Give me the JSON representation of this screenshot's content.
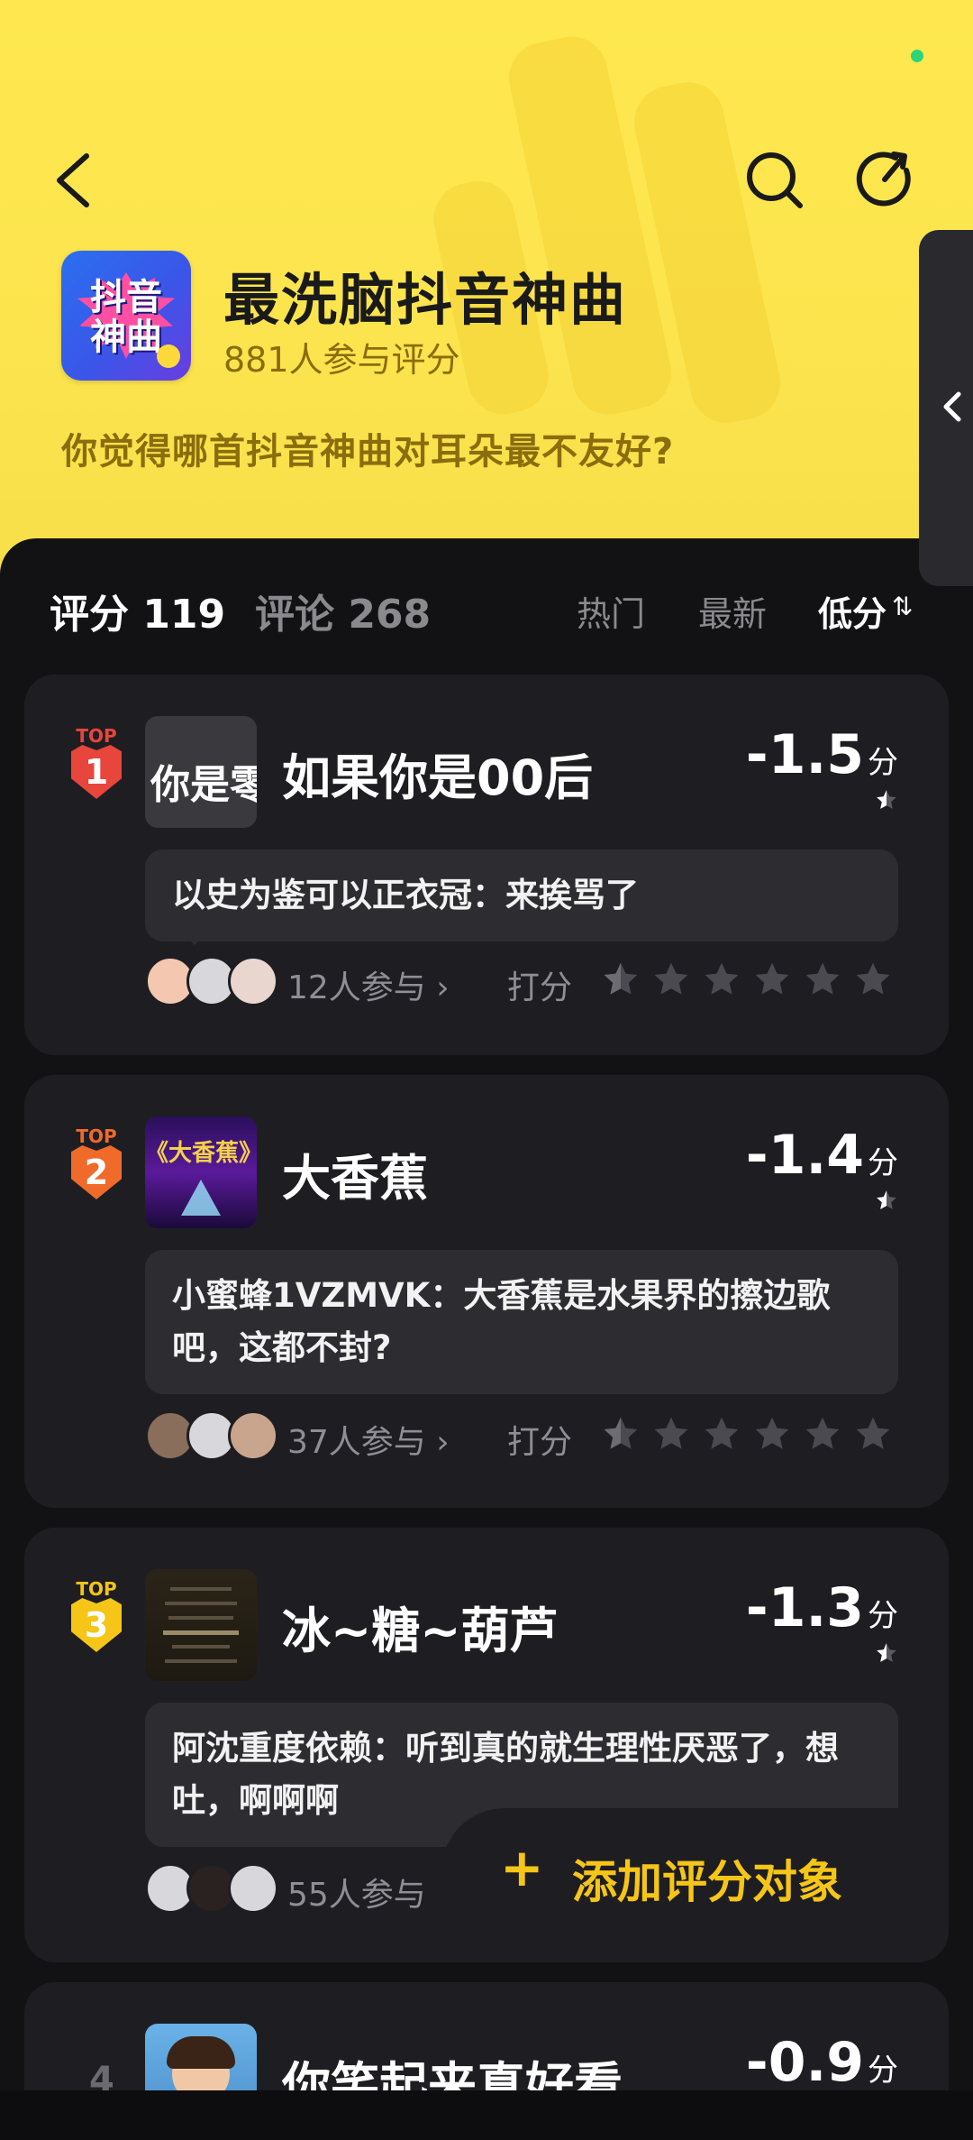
{
  "header": {
    "title": "最洗脑抖音神曲",
    "participants": "881人参与评分",
    "question": "你觉得哪首抖音神曲对耳朵最不友好?",
    "cover_text": "抖音神曲"
  },
  "tabs": {
    "score_label": "评分 119",
    "comment_label": "评论 268"
  },
  "sort": {
    "hot": "热门",
    "new": "最新",
    "low": "低分",
    "low_icon": "⇅"
  },
  "items": [
    {
      "rank_top": "TOP",
      "rank": "1",
      "thumb_text": "你是零",
      "title": "如果你是00后",
      "score": "-1.5",
      "unit": "分",
      "comment": "以史为鉴可以正衣冠：来挨骂了",
      "join": "12人参与 ›",
      "rate": "打分"
    },
    {
      "rank_top": "TOP",
      "rank": "2",
      "thumb_text": "《大香蕉》",
      "title": "大香蕉",
      "score": "-1.4",
      "unit": "分",
      "comment": "小蜜蜂1VZMVK：大香蕉是水果界的擦边歌吧，这都不封?",
      "join": "37人参与 ›",
      "rate": "打分"
    },
    {
      "rank_top": "TOP",
      "rank": "3",
      "title": "冰~糖~葫芦",
      "score": "-1.3",
      "unit": "分",
      "comment": "阿沈重度依赖：听到真的就生理性厌恶了，想吐，啊啊啊",
      "join": "55人参与"
    },
    {
      "rank": "4",
      "title": "你笑起来真好看",
      "score": "-0.9",
      "unit": "分"
    }
  ],
  "add_button": {
    "plus": "+",
    "label": "添加评分对象"
  },
  "colors": {
    "header_yellow": "#ffe84f",
    "accent": "#f5c518",
    "rank1": "#e8453c",
    "rank2": "#f06a2a",
    "rank3": "#f5c518"
  }
}
